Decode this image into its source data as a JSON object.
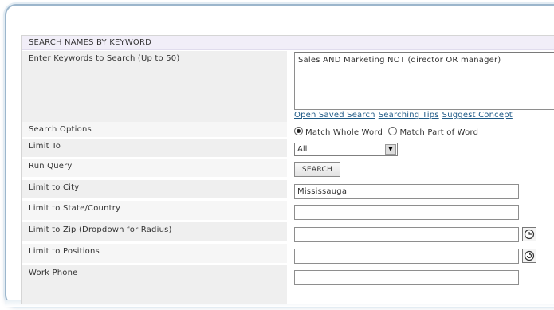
{
  "section": {
    "title": "SEARCH NAMES BY KEYWORD"
  },
  "rows": [
    {
      "label": "Enter Keywords to Search (Up to 50)"
    },
    {
      "label": "Search Options"
    },
    {
      "label": "Limit To"
    },
    {
      "label": "Run Query"
    },
    {
      "label": "Limit to City"
    },
    {
      "label": "Limit to State/Country"
    },
    {
      "label": "Limit to Zip (Dropdown for Radius)"
    },
    {
      "label": "Limit to Positions"
    },
    {
      "label": "Work Phone"
    }
  ],
  "keywords": {
    "value": "Sales AND Marketing NOT (director OR manager)"
  },
  "links": {
    "open_saved": "Open Saved Search",
    "tips": "Searching Tips",
    "suggest": "Suggest Concept"
  },
  "search_options": {
    "whole": "Match Whole Word",
    "part": "Match Part of Word",
    "selected": "whole"
  },
  "limit_to": {
    "value": "All"
  },
  "run_query": {
    "button": "SEARCH"
  },
  "city": {
    "value": "Mississauga"
  },
  "state": {
    "value": ""
  },
  "zip": {
    "value": "",
    "icon": "clock-icon"
  },
  "positions": {
    "value": "",
    "icon": "refresh-icon"
  },
  "work_phone": {
    "value": ""
  },
  "colors": {
    "header_bg": "#f1eef8",
    "link": "#1f5a87",
    "row_bg": "#efefef",
    "frame": "#9cb6cc"
  }
}
